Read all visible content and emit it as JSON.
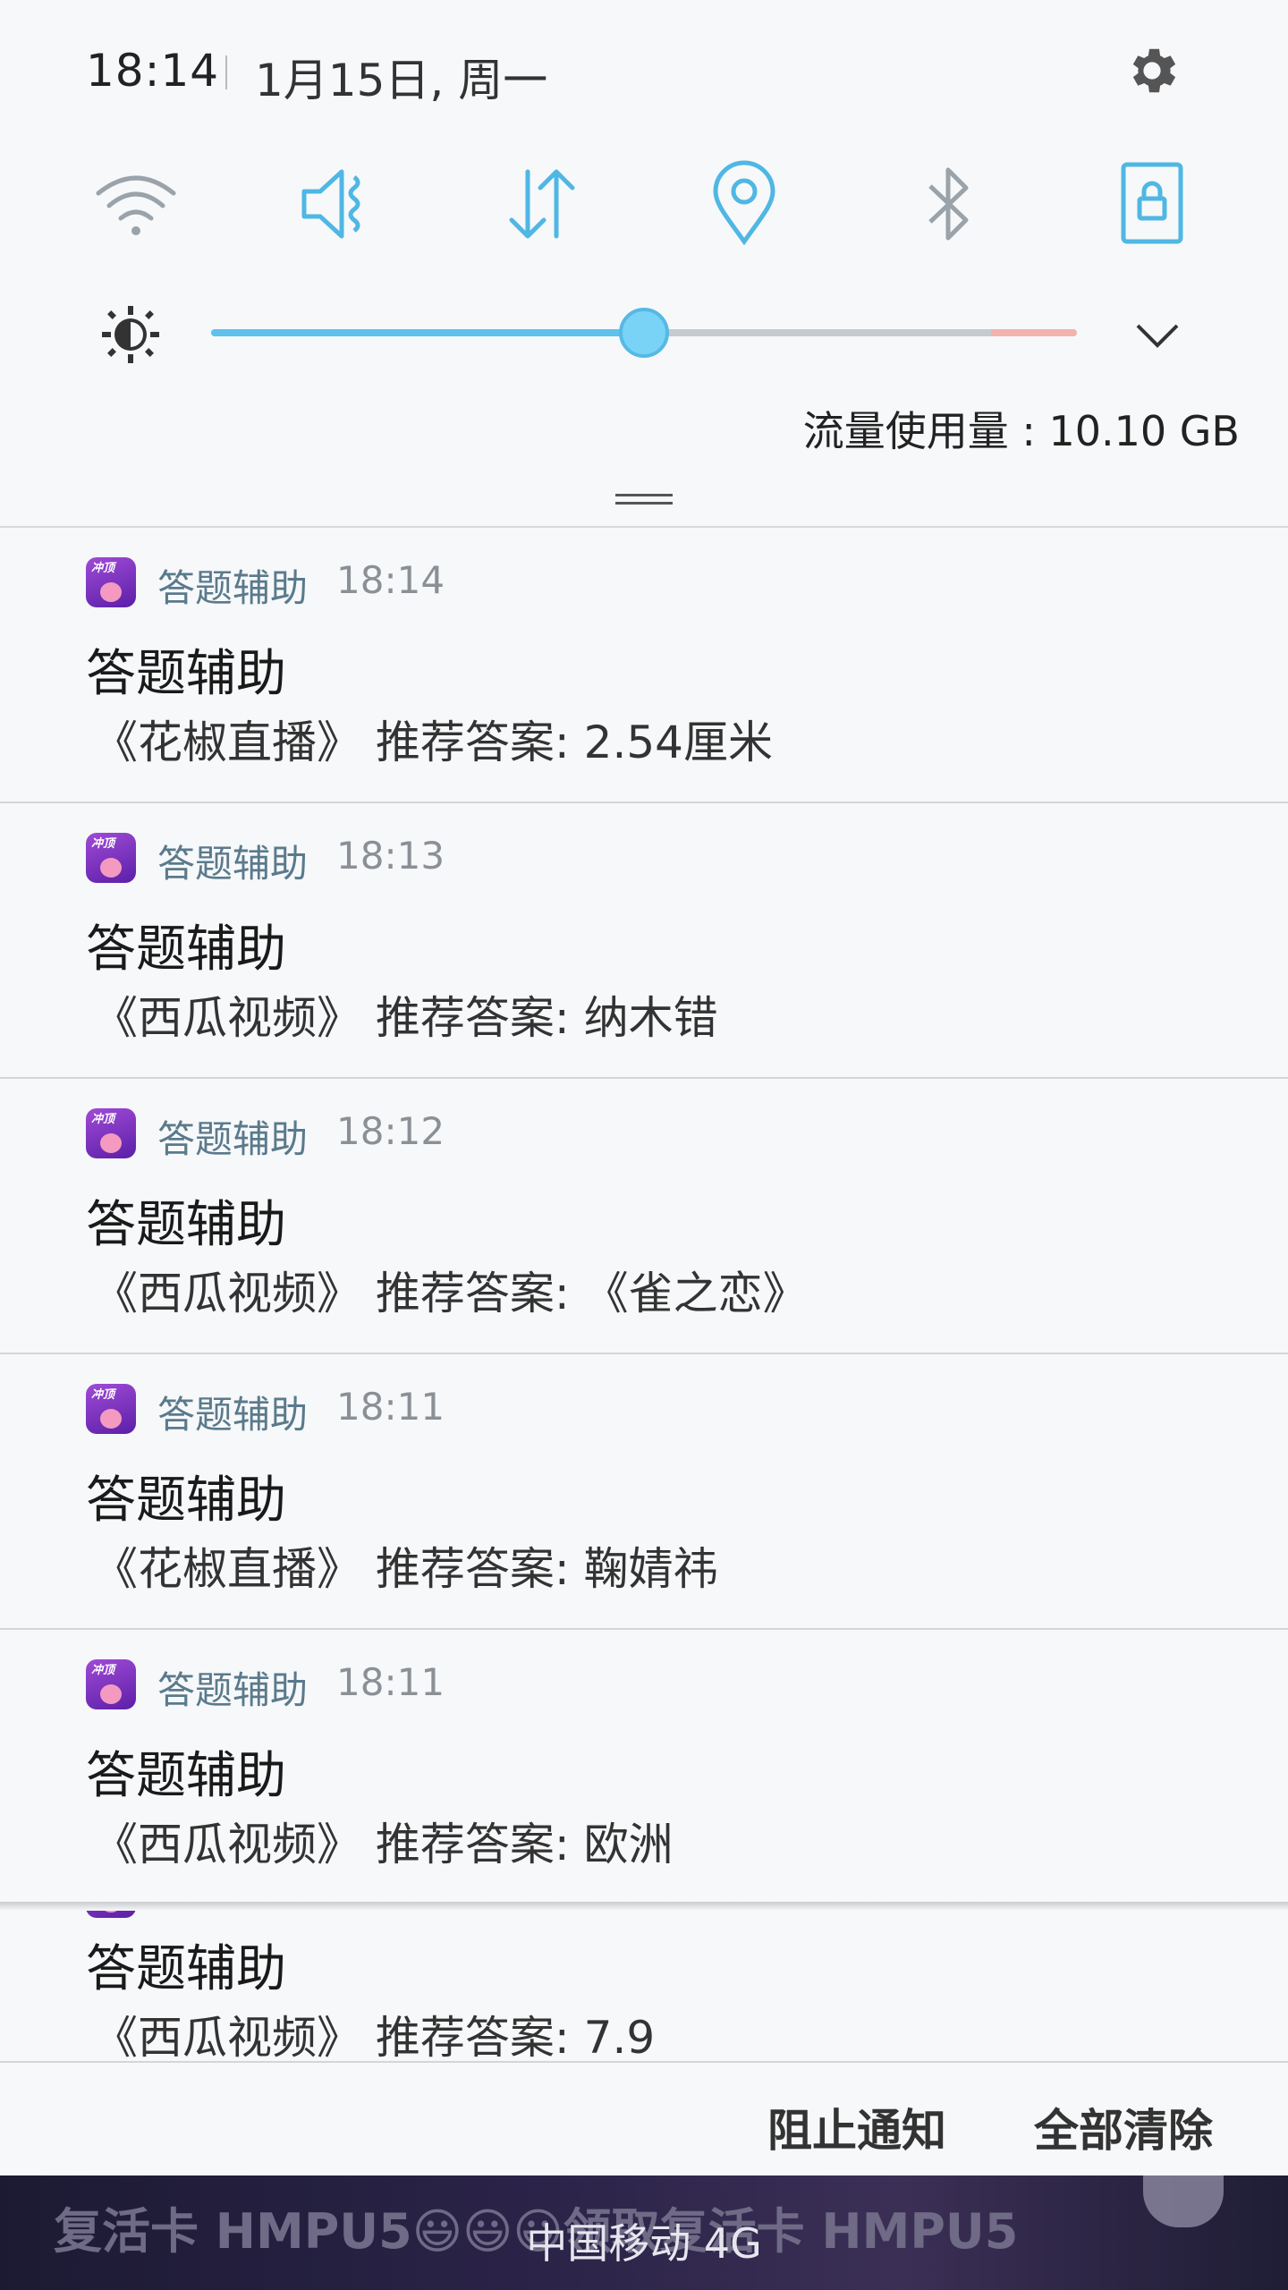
{
  "status": {
    "time": "18:14",
    "date": "1月15日, 周一"
  },
  "quick_settings": [
    {
      "icon": "wifi-icon",
      "color": "#9aa3aa"
    },
    {
      "icon": "sound-mute-icon",
      "color": "#4fb7e3"
    },
    {
      "icon": "mobile-data-icon",
      "color": "#4fb7e3"
    },
    {
      "icon": "location-icon",
      "color": "#4fb7e3"
    },
    {
      "icon": "bluetooth-icon",
      "color": "#9aa3aa"
    },
    {
      "icon": "screen-lock-icon",
      "color": "#4fb7e3"
    }
  ],
  "brightness": {
    "level_percent": 50
  },
  "data_usage": "流量使用量 : 10.10 GB",
  "notifications": [
    {
      "app": "答题辅助",
      "time": "18:14",
      "title": "答题辅助",
      "body": "《花椒直播》 推荐答案: 2.54厘米"
    },
    {
      "app": "答题辅助",
      "time": "18:13",
      "title": "答题辅助",
      "body": "《西瓜视频》 推荐答案: 纳木错"
    },
    {
      "app": "答题辅助",
      "time": "18:12",
      "title": "答题辅助",
      "body": "《西瓜视频》 推荐答案: 《雀之恋》"
    },
    {
      "app": "答题辅助",
      "time": "18:11",
      "title": "答题辅助",
      "body": "《花椒直播》 推荐答案: 鞠婧祎"
    },
    {
      "app": "答题辅助",
      "time": "18:11",
      "title": "答题辅助",
      "body": "《西瓜视频》 推荐答案: 欧洲"
    }
  ],
  "partial_notification": {
    "title": "答题辅助",
    "body": "《西瓜视频》 推荐答案: 7.9"
  },
  "actions": {
    "block": "阻止通知",
    "clear_all": "全部清除"
  },
  "bottom": {
    "marquee": "复活卡 HMPU5😃😃😃领取复活卡 HMPU5",
    "carrier": "中国移动 4G"
  },
  "app_icon_text": "冲顶"
}
